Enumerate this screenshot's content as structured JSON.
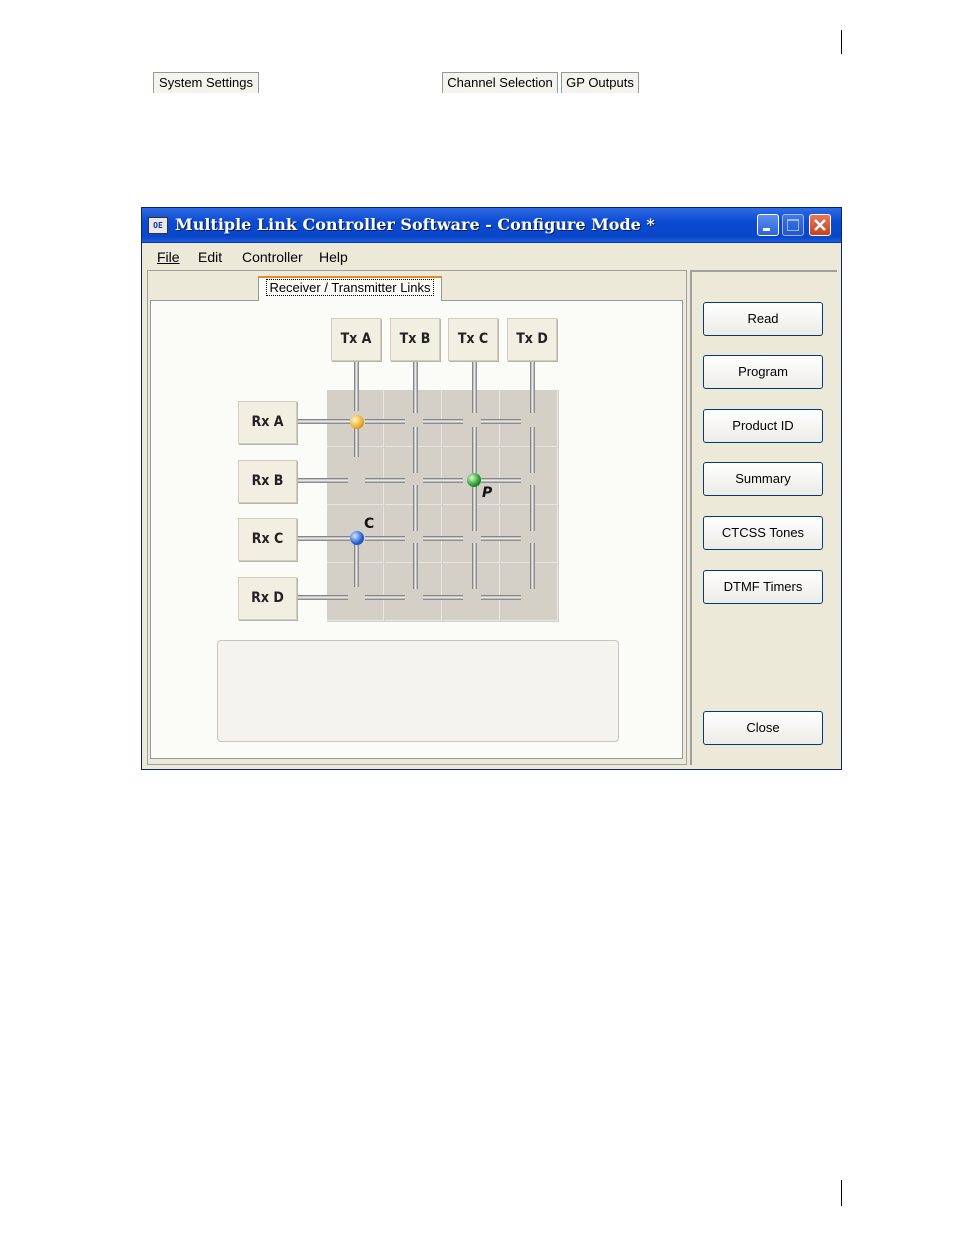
{
  "window": {
    "title": "Multiple Link Controller Software - Configure Mode *",
    "icon": "app-logo-icon"
  },
  "menu": [
    {
      "label": "File"
    },
    {
      "label": "Edit"
    },
    {
      "label": "Controller"
    },
    {
      "label": "Help"
    }
  ],
  "tabs": [
    {
      "label": "System Settings",
      "active": false
    },
    {
      "label": "Receiver / Transmitter  Links",
      "active": true
    },
    {
      "label": "Channel Selection",
      "active": false
    },
    {
      "label": "GP Outputs",
      "active": false
    }
  ],
  "matrix": {
    "transmitters": [
      "Tx A",
      "Tx B",
      "Tx C",
      "Tx D"
    ],
    "receivers": [
      "Rx A",
      "Rx B",
      "Rx C",
      "Rx D"
    ],
    "links": [
      {
        "rx": "Rx A",
        "tx": "Tx A",
        "color": "#f0b030",
        "label": ""
      },
      {
        "rx": "Rx B",
        "tx": "Tx C",
        "color": "#2e9e2e",
        "label": "P"
      },
      {
        "rx": "Rx C",
        "tx": "Tx A",
        "color": "#2a64d8",
        "label": "C"
      }
    ]
  },
  "status_text": "",
  "buttons": [
    {
      "label": "Read"
    },
    {
      "label": "Program"
    },
    {
      "label": "Product ID"
    },
    {
      "label": "Summary"
    },
    {
      "label": "CTCSS Tones"
    },
    {
      "label": "DTMF Timers"
    },
    {
      "label": "Close"
    }
  ],
  "colors": {
    "titlebar": "#0b4bd2",
    "window_bg": "#ece9d8",
    "tab_accent": "#e68b2c"
  }
}
